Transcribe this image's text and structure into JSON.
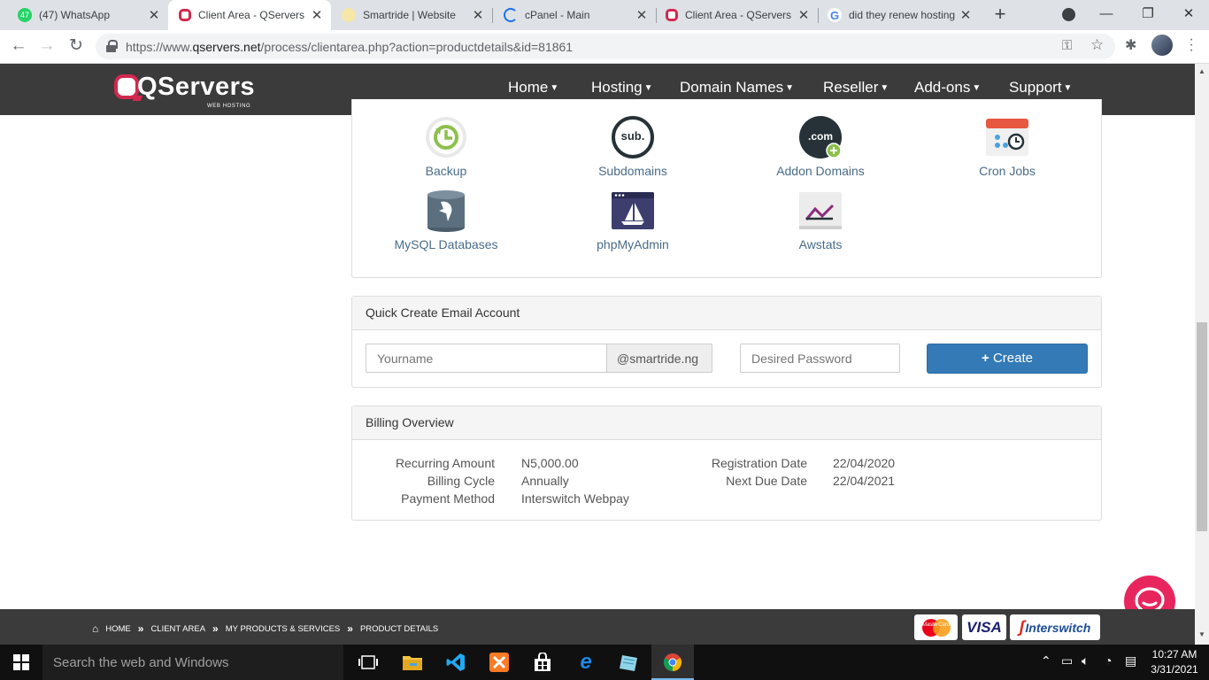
{
  "tabs": [
    {
      "title": "(47) WhatsApp",
      "badge": "47"
    },
    {
      "title": "Client Area - QServers"
    },
    {
      "title": "Smartride | Website"
    },
    {
      "title": "cPanel - Main"
    },
    {
      "title": "Client Area - QServers"
    },
    {
      "title": "did they renew hosting"
    }
  ],
  "address": {
    "scheme": "https://www.",
    "domain": "qservers.net",
    "path": "/process/clientarea.php?action=productdetails&id=81861"
  },
  "site": {
    "brand": "QServers",
    "tagline": "WEB HOSTING",
    "menu": [
      "Home",
      "Hosting",
      "Domain Names",
      "Reseller",
      "Add-ons",
      "Support"
    ]
  },
  "tools": [
    {
      "label": "Backup",
      "icon": "backup-icon"
    },
    {
      "label": "Subdomains",
      "icon": "subdomains-icon",
      "glyph": "sub."
    },
    {
      "label": "Addon Domains",
      "icon": "addon-domains-icon",
      "glyph": ".com"
    },
    {
      "label": "Cron Jobs",
      "icon": "cron-jobs-icon"
    },
    {
      "label": "MySQL Databases",
      "icon": "mysql-databases-icon"
    },
    {
      "label": "phpMyAdmin",
      "icon": "phpmyadmin-icon"
    },
    {
      "label": "Awstats",
      "icon": "awstats-icon"
    }
  ],
  "email": {
    "heading": "Quick Create Email Account",
    "username_placeholder": "Yourname",
    "domain_suffix": "@smartride.ng",
    "password_placeholder": "Desired Password",
    "create_label": "Create"
  },
  "billing": {
    "heading": "Billing Overview",
    "left": [
      {
        "label": "Recurring Amount",
        "value": "N5,000.00"
      },
      {
        "label": "Billing Cycle",
        "value": "Annually"
      },
      {
        "label": "Payment Method",
        "value": "Interswitch Webpay"
      }
    ],
    "right": [
      {
        "label": "Registration Date",
        "value": "22/04/2020"
      },
      {
        "label": "Next Due Date",
        "value": "22/04/2021"
      }
    ]
  },
  "breadcrumb": [
    "HOME",
    "CLIENT AREA",
    "MY PRODUCTS & SERVICES",
    "PRODUCT DETAILS"
  ],
  "payment_logos": {
    "mastercard": "MasterCard",
    "visa": "VISA",
    "interswitch": "Interswitch"
  },
  "taskbar": {
    "search_placeholder": "Search the web and Windows",
    "time": "10:27 AM",
    "date": "3/31/2021"
  },
  "colors": {
    "brand": "#d3284f",
    "navbar": "#3b3b3b",
    "button": "#337ab7",
    "link": "#4a6c8a"
  }
}
